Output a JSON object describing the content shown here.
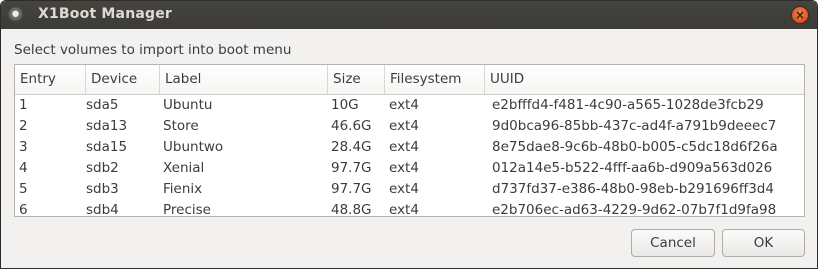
{
  "window": {
    "title": "X1Boot Manager",
    "close_glyph": "×"
  },
  "prompt": "Select volumes to import into boot menu",
  "table": {
    "columns": [
      "Entry",
      "Device",
      "Label",
      "Size",
      "Filesystem",
      "UUID"
    ],
    "rows": [
      [
        "1",
        "sda5",
        "Ubuntu",
        "10G",
        "ext4",
        "e2bfffd4-f481-4c90-a565-1028de3fcb29"
      ],
      [
        "2",
        "sda13",
        "Store",
        "46.6G",
        "ext4",
        "9d0bca96-85bb-437c-ad4f-a791b9deeec7"
      ],
      [
        "3",
        "sda15",
        "Ubuntwo",
        "28.4G",
        "ext4",
        "8e75dae8-9c6b-48b0-b005-c5dc18d6f26a"
      ],
      [
        "4",
        "sdb2",
        "Xenial",
        "97.7G",
        "ext4",
        "012a14e5-b522-4fff-aa6b-d909a563d026"
      ],
      [
        "5",
        "sdb3",
        "Fienix",
        "97.7G",
        "ext4",
        "d737fd37-e386-48b0-98eb-b291696ff3d4"
      ],
      [
        "6",
        "sdb4",
        "Precise",
        "48.8G",
        "ext4",
        "e2b706ec-ad63-4229-9d62-07b7f1d9fa98"
      ]
    ]
  },
  "buttons": {
    "cancel": "Cancel",
    "ok": "OK"
  },
  "icons": {
    "app": "app-icon",
    "close": "close-icon"
  },
  "colors": {
    "titlebar": "#3c3b37",
    "close_button": "#e05a25",
    "window_bg": "#f2f1f0"
  }
}
